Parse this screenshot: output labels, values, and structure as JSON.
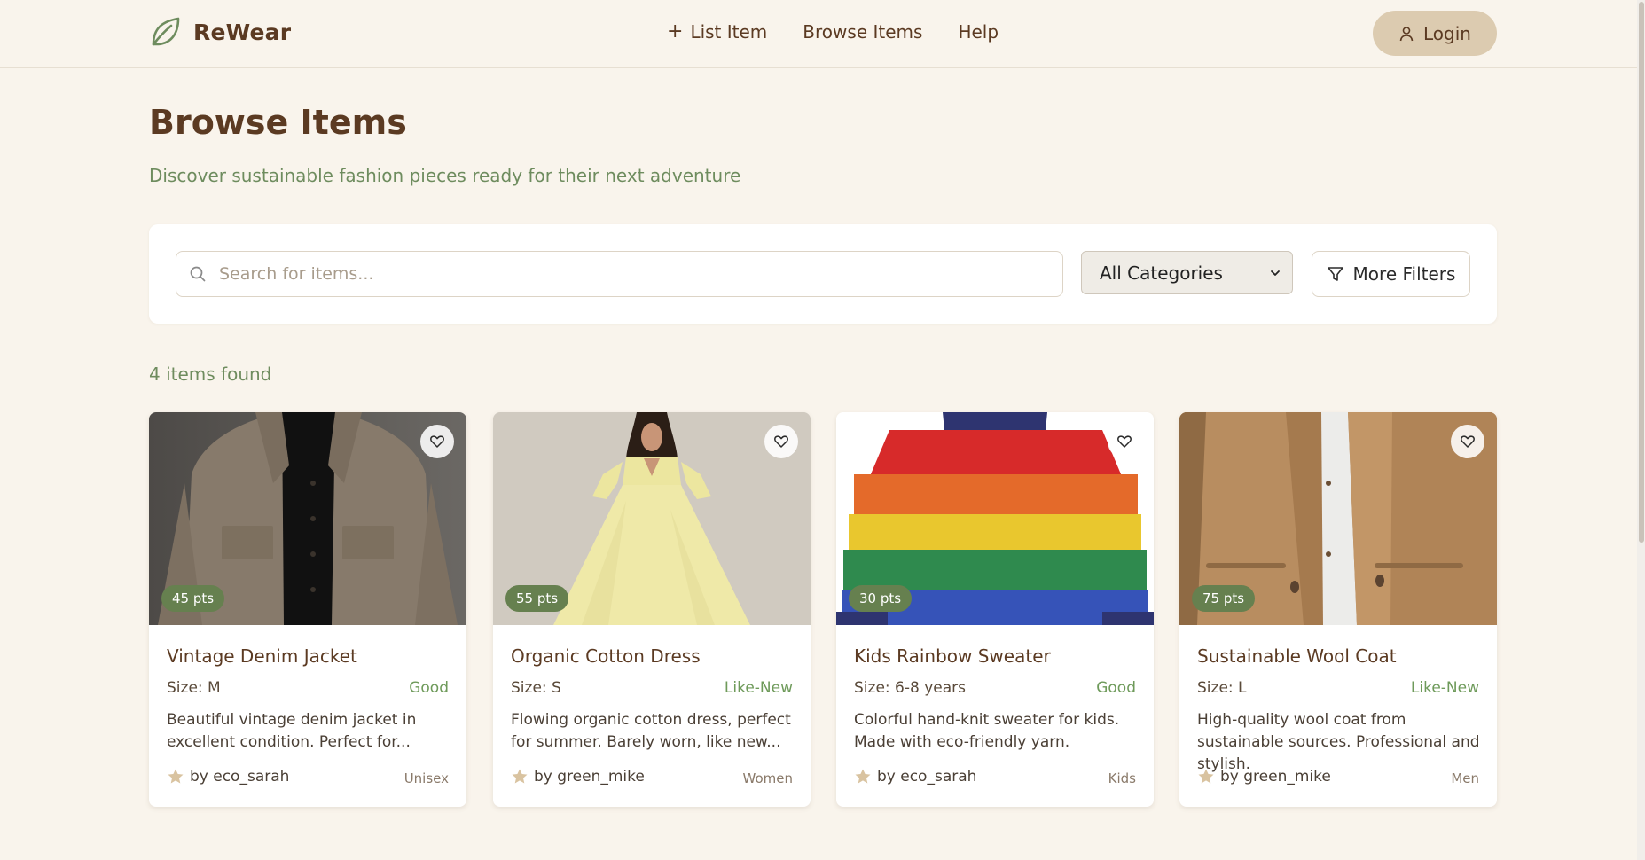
{
  "header": {
    "brand": "ReWear",
    "nav": [
      {
        "label": "List Item"
      },
      {
        "label": "Browse Items"
      },
      {
        "label": "Help"
      }
    ],
    "login_label": "Login"
  },
  "page": {
    "title": "Browse Items",
    "subtitle": "Discover sustainable fashion pieces ready for their next adventure"
  },
  "search": {
    "placeholder": "Search for items...",
    "category_selected": "All Categories",
    "filters_label": "More Filters"
  },
  "results": {
    "count_text": "4 items found"
  },
  "items": [
    {
      "title": "Vintage Denim Jacket",
      "points": "45 pts",
      "size": "Size: M",
      "condition": "Good",
      "description": "Beautiful vintage denim jacket in excellent condition. Perfect for...",
      "owner": "by eco_sarah",
      "category": "Unisex"
    },
    {
      "title": "Organic Cotton Dress",
      "points": "55 pts",
      "size": "Size: S",
      "condition": "Like-New",
      "description": "Flowing organic cotton dress, perfect for summer. Barely worn, like new...",
      "owner": "by green_mike",
      "category": "Women"
    },
    {
      "title": "Kids Rainbow Sweater",
      "points": "30 pts",
      "size": "Size: 6-8 years",
      "condition": "Good",
      "description": "Colorful hand-knit sweater for kids. Made with eco-friendly yarn.",
      "owner": "by eco_sarah",
      "category": "Kids"
    },
    {
      "title": "Sustainable Wool Coat",
      "points": "75 pts",
      "size": "Size: L",
      "condition": "Like-New",
      "description": "High-quality wool coat from sustainable sources. Professional and stylish.",
      "owner": "by green_mike",
      "category": "Men"
    }
  ],
  "colors": {
    "background": "#f9f4ec",
    "brand_brown": "#5b3a22",
    "accent_green": "#66804f",
    "login_bg": "#dccbb0"
  },
  "icons": {
    "brand": "leaf-icon",
    "list_item": "plus-icon",
    "login": "user-icon",
    "search": "search-icon",
    "filters": "filter-icon",
    "favorite": "heart-icon",
    "owner": "star-icon"
  }
}
